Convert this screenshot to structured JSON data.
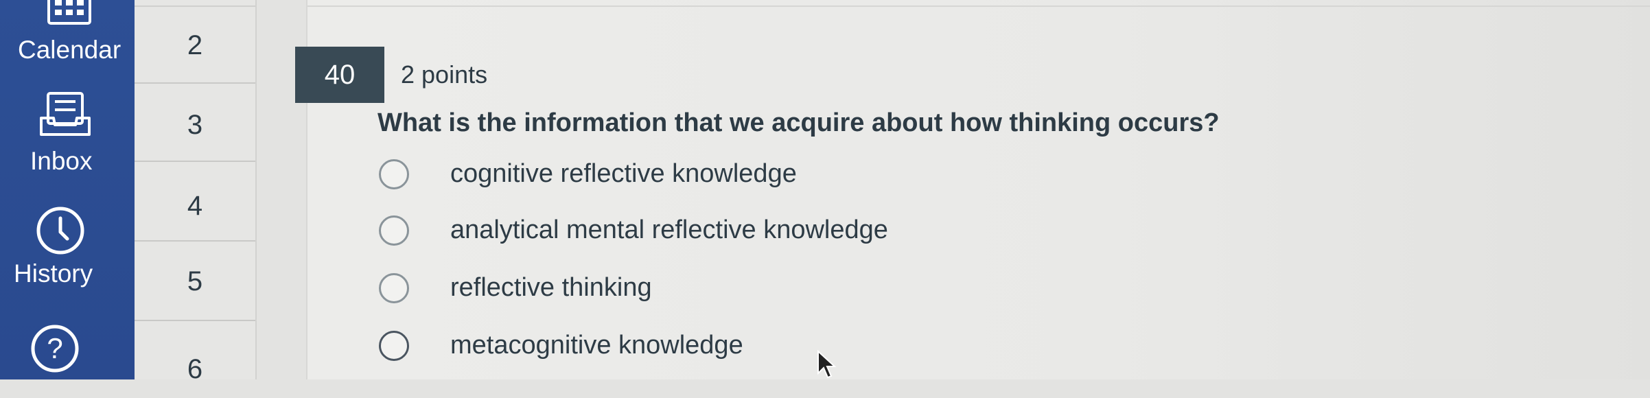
{
  "nav": {
    "items": [
      {
        "label": "Calendar",
        "icon": "calendar-icon"
      },
      {
        "label": "Inbox",
        "icon": "inbox-icon"
      },
      {
        "label": "History",
        "icon": "history-icon"
      },
      {
        "label": "",
        "icon": "help-icon"
      }
    ]
  },
  "question_nav": {
    "numbers": [
      "2",
      "3",
      "4",
      "5",
      "6"
    ]
  },
  "question": {
    "number": "40",
    "points": "2 points",
    "text": "What is the information that we acquire about how thinking occurs?",
    "options": [
      "cognitive reflective knowledge",
      "analytical mental reflective knowledge",
      "reflective thinking",
      "metacognitive knowledge"
    ]
  },
  "colors": {
    "nav_bg": "#2d4f95",
    "badge_bg": "#394a55",
    "text": "#2d3b45"
  }
}
